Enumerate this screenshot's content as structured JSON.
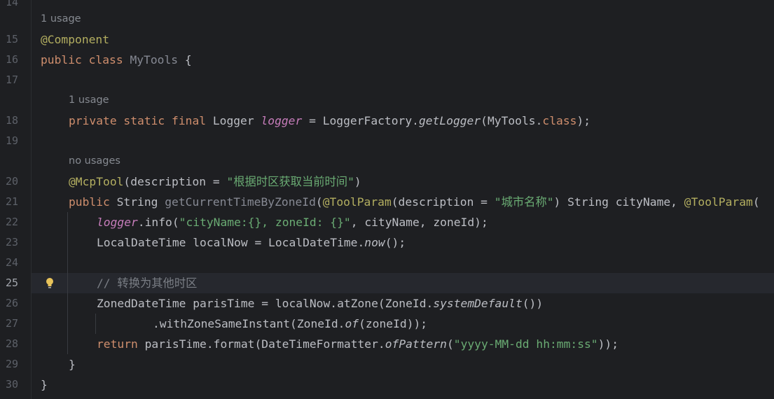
{
  "editor": {
    "hints": {
      "class_usage": "1 usage",
      "logger_usage": "1 usage",
      "method_usage": "no usages"
    },
    "line_numbers": [
      "15",
      "16",
      "17",
      "18",
      "19",
      "20",
      "21",
      "22",
      "23",
      "24",
      "25",
      "26",
      "27",
      "28",
      "29",
      "30"
    ],
    "current_line": "25",
    "code": {
      "l15_annotation": "@Component",
      "l16_kw": "public class",
      "l16_name": "MyTools",
      "l16_rest": " {",
      "l18_kw": "private static final",
      "l18_type": " Logger ",
      "l18_field": "logger",
      "l18_mid": " = LoggerFactory.",
      "l18_method": "getLogger",
      "l18_arg": "(MyTools.",
      "l18_class_kw": "class",
      "l18_end": ");",
      "l20_annotation": "@McpTool",
      "l20_mid": "(description = ",
      "l20_string": "\"根据时区获取当前时间\"",
      "l20_end": ")",
      "l21_kw": "public",
      "l21_type": " String ",
      "l21_method": "getCurrentTimeByZoneId",
      "l21_paren": "(",
      "l21_annotation": "@ToolParam",
      "l21_mid": "(description = ",
      "l21_string": "\"城市名称\"",
      "l21_rest": ") String cityName, ",
      "l21_annotation2": "@ToolParam",
      "l21_tail": "(",
      "l22_field": "logger",
      "l22_mid": ".info(",
      "l22_string": "\"cityName:{}, zoneId: {}\"",
      "l22_end": ", cityName, zoneId);",
      "l23_start": "LocalDateTime localNow = LocalDateTime.",
      "l23_method": "now",
      "l23_end": "();",
      "l25_comment": "// 转换为其他时区",
      "l26_start": "ZonedDateTime parisTime = localNow.atZone(ZoneId.",
      "l26_method": "systemDefault",
      "l26_end": "())",
      "l27_start": ".withZoneSameInstant(ZoneId.",
      "l27_method": "of",
      "l27_end": "(zoneId));",
      "l28_kw": "return",
      "l28_mid": " parisTime.format(DateTimeFormatter.",
      "l28_method": "ofPattern",
      "l28_paren": "(",
      "l28_string": "\"yyyy-MM-dd hh:mm:ss\"",
      "l28_end": "));",
      "l29_brace": "}",
      "l30_brace": "}"
    }
  },
  "colors": {
    "background": "#1e1f22",
    "keyword": "#cf8e6d",
    "annotation": "#b3ae60",
    "string": "#6aab73",
    "field": "#c77dbb",
    "comment": "#7a7e85"
  },
  "icons": {
    "current_line_gutter": "lightbulb-icon"
  }
}
